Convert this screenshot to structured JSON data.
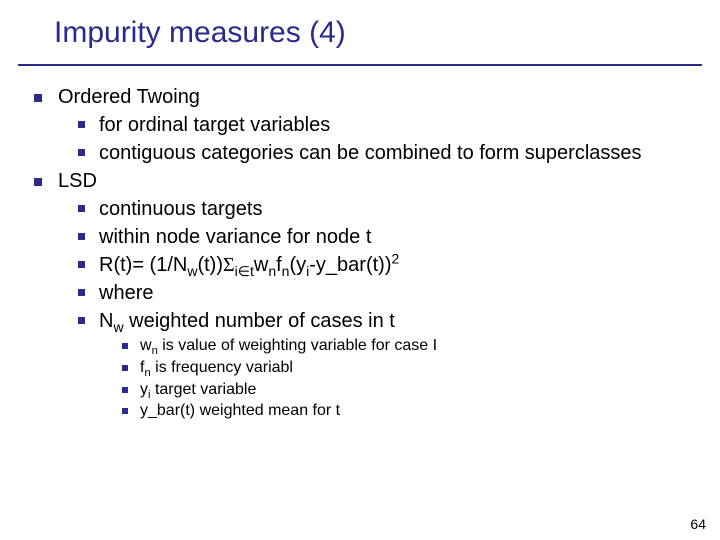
{
  "title": "Impurity measures (4)",
  "items": {
    "a": {
      "label": "Ordered Twoing",
      "sub": {
        "a": "for ordinal target variables",
        "b": "contiguous categories can be combined to form superclasses"
      }
    },
    "b": {
      "label": "LSD",
      "sub": {
        "a": "continuous targets",
        "b": "within node variance for node t",
        "c_html": "R(t)= (1/N<sub>w</sub>(t))<span class='sigma'>&Sigma;</span><sub>i&isin;t</sub>w<sub>n</sub>f<sub>n</sub>(y<sub>i</sub>-y_bar(t))<sup>2</sup>",
        "d": "where",
        "e_html": "N<sub>w</sub> weighted number of cases in t",
        "e_sub": {
          "a_html": "w<sub>n</sub> is value of weighting variable for case I",
          "b_html": "f<sub>n</sub> is frequency variabl",
          "c_html": "y<sub>i</sub> target variable",
          "d": "y_bar(t) weighted mean for t"
        }
      }
    }
  },
  "page_number": "64"
}
